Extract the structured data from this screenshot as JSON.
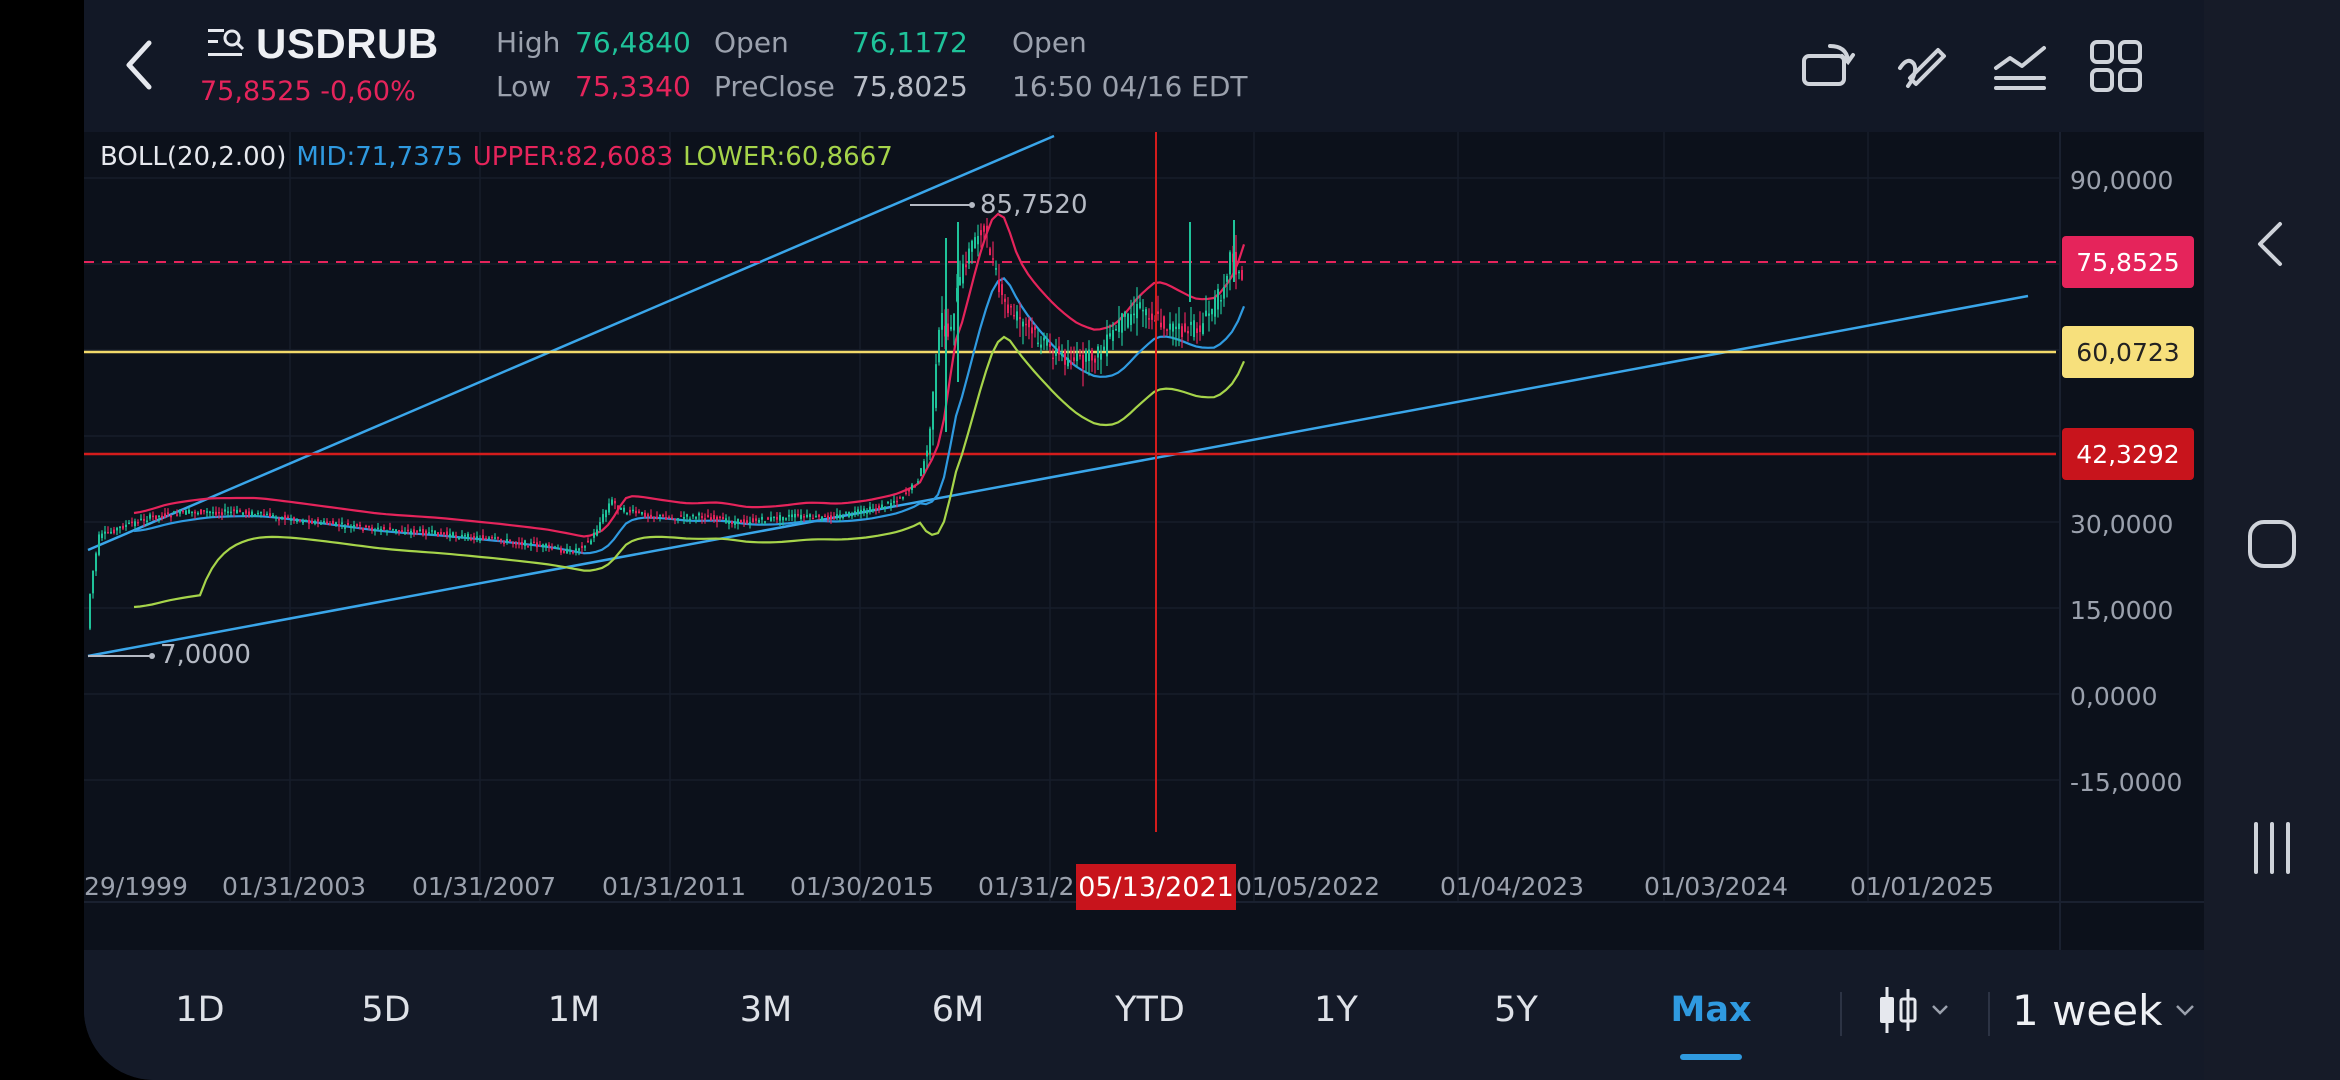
{
  "header": {
    "symbol": "USDRUB",
    "price_line": "75,8525 -0,60%",
    "high_label": "High",
    "high_value": "76,4840",
    "low_label": "Low",
    "low_value": "75,3340",
    "open_label": "Open",
    "open_value": "76,1172",
    "preclose_label": "PreClose",
    "preclose_value": "75,8025",
    "status_label": "Open",
    "status_time": "16:50 04/16 EDT"
  },
  "toolbar_icons": [
    "rotate-screen-icon",
    "draw-pen-icon",
    "indicator-icon",
    "grid-apps-icon"
  ],
  "indicator": {
    "name": "BOLL(20,2.00)",
    "mid": "MID:71,7375",
    "upper": "UPPER:82,6083",
    "lower": "LOWER:60,8667"
  },
  "chart": {
    "y_ticks": [
      "90,0000",
      "30,0000",
      "15,0000",
      "0,0000",
      "-15,0000"
    ],
    "x_ticks": [
      "29/1999",
      "01/31/2003",
      "01/31/2007",
      "01/31/2011",
      "01/30/2015",
      "01/31/2",
      "01/05/2022",
      "01/04/2023",
      "01/03/2024",
      "01/01/2025"
    ],
    "crosshair_date": "05/13/2021",
    "tags": {
      "current": "75,8525",
      "yellow_line": "60,0723",
      "red_line": "42,3292"
    },
    "max_note": "85,7520",
    "min_note": "7,0000",
    "colors": {
      "bull": "#1fc39a",
      "bear": "#e5245b",
      "mid": "#2f9ae0",
      "upper": "#e5245b",
      "lower": "#a6d44a",
      "trend": "#3aa6ea",
      "yellow": "#f2d96a",
      "red": "#d41c1c"
    }
  },
  "periods": [
    "1D",
    "5D",
    "1M",
    "3M",
    "6M",
    "YTD",
    "1Y",
    "5Y",
    "Max"
  ],
  "active_period": "Max",
  "interval": "1 week",
  "nav_icons": [
    "back-chevron-icon",
    "home-icon",
    "recents-icon"
  ]
}
